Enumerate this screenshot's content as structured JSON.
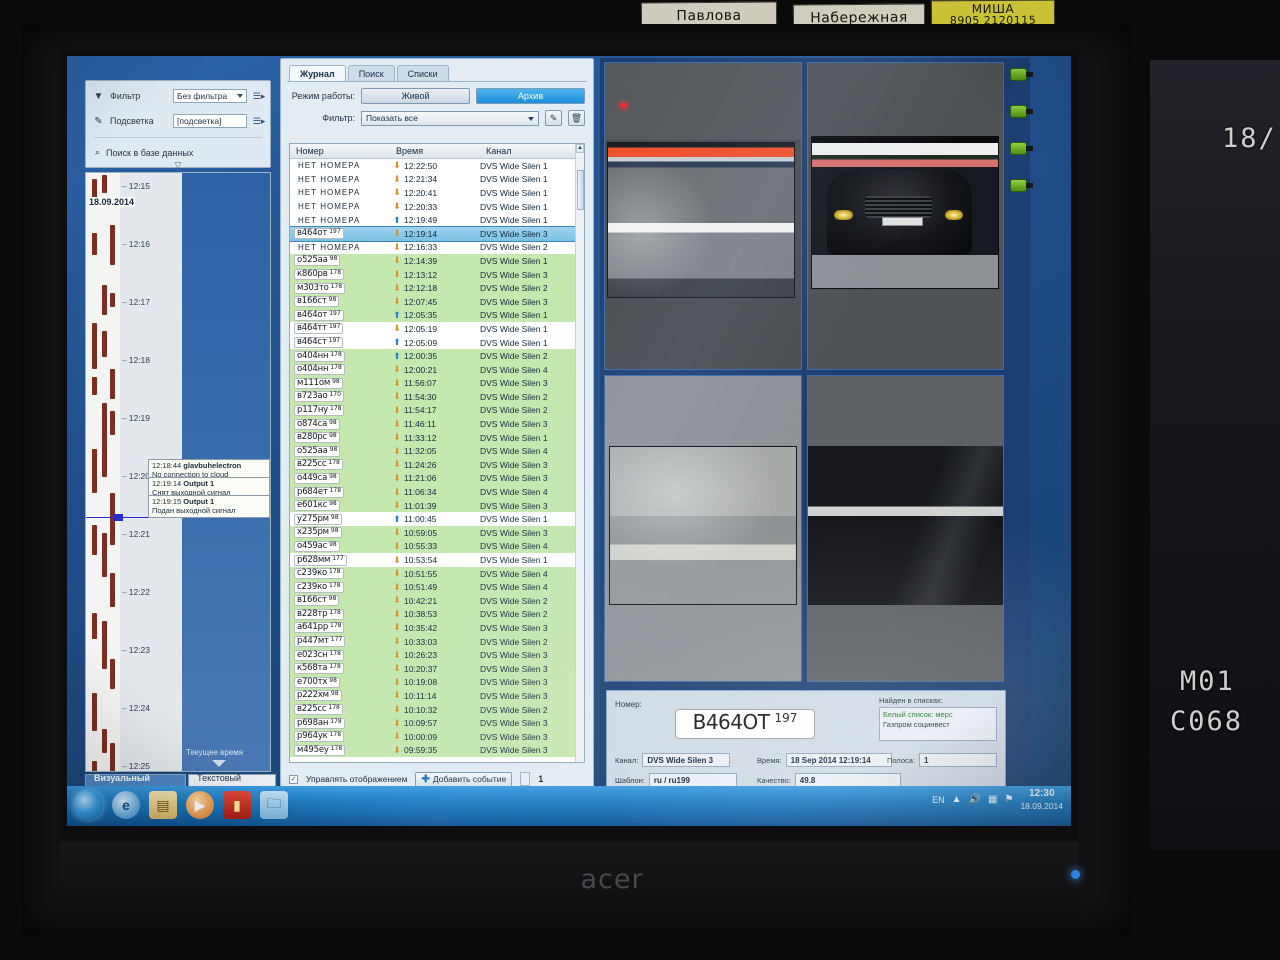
{
  "room": {
    "sticky_notes": [
      {
        "text": "Павлова"
      },
      {
        "text": "Набережная"
      },
      {
        "text": "МИША",
        "text2": "8905 2120115"
      }
    ],
    "second_monitor": {
      "line1": "18/",
      "line2": "M01",
      "line3": "C068"
    },
    "laptop_brand": "acer"
  },
  "left_panel": {
    "filter_label": "Фильтр",
    "filter_value": "Без фильтра",
    "highlight_label": "Подсветка",
    "highlight_placeholder": "[подсветка]",
    "search_db": "Поиск в базе данных",
    "date_stamp": "18.09.2014",
    "ticks": [
      "12:15",
      "12:16",
      "12:17",
      "12:18",
      "12:19",
      "12:20",
      "12:21",
      "12:22",
      "12:23",
      "12:24",
      "12:25"
    ],
    "current_time_label": "Текущее время",
    "tooltips": [
      {
        "time": "12:18:44",
        "title": "glavbuhelectron",
        "body": "No connection to cloud"
      },
      {
        "time": "12:19:14",
        "title": "Output 1",
        "body": "Снят выходной сигнал"
      },
      {
        "time": "12:19:15",
        "title": "Output 1",
        "body": "Подан выходной сигнал"
      }
    ],
    "mode_tabs": [
      {
        "label": "Визуальный режим",
        "active": true
      },
      {
        "label": "Текстовый режим",
        "active": false
      }
    ]
  },
  "journal": {
    "tabs": [
      {
        "label": "Журнал",
        "active": true
      },
      {
        "label": "Поиск",
        "active": false
      },
      {
        "label": "Списки",
        "active": false
      }
    ],
    "mode_label": "Режим работы:",
    "mode_live": "Живой",
    "mode_archive": "Архив",
    "filter_label": "Фильтр:",
    "filter_value": "Показать все",
    "edit_icon": "pencil-icon",
    "delete_icon": "trash-icon",
    "columns": [
      "Номер",
      "Время",
      "Канал"
    ],
    "footer": {
      "checkbox_label": "Управлять отображением",
      "checkbox_checked": true,
      "add_event": "Добавить событие",
      "counter": "1"
    },
    "rows": [
      {
        "plate": null,
        "noplate": "НЕТ НОМЕРА",
        "dir": "down",
        "time": "12:22:50",
        "channel": "DVS Wide Silen 1",
        "bg": "white"
      },
      {
        "plate": null,
        "noplate": "НЕТ НОМЕРА",
        "dir": "down",
        "time": "12:21:34",
        "channel": "DVS Wide Silen 1",
        "bg": "white"
      },
      {
        "plate": null,
        "noplate": "НЕТ НОМЕРА",
        "dir": "down",
        "time": "12:20:41",
        "channel": "DVS Wide Silen 1",
        "bg": "white"
      },
      {
        "plate": null,
        "noplate": "НЕТ НОМЕРА",
        "dir": "down",
        "time": "12:20:33",
        "channel": "DVS Wide Silen 1",
        "bg": "white"
      },
      {
        "plate": null,
        "noplate": "НЕТ НОМЕРА",
        "dir": "up",
        "time": "12:19:49",
        "channel": "DVS Wide Silen 1",
        "bg": "white"
      },
      {
        "plate": "в464от",
        "region": "197",
        "dir": "down",
        "time": "12:19:14",
        "channel": "DVS Wide Silen 3",
        "bg": "sel"
      },
      {
        "plate": null,
        "noplate": "НЕТ НОМЕРА",
        "dir": "down",
        "time": "12:16:33",
        "channel": "DVS Wide Silen 2",
        "bg": "white"
      },
      {
        "plate": "о525аа",
        "region": "98",
        "dir": "down",
        "time": "12:14:39",
        "channel": "DVS Wide Silen 1",
        "bg": "green"
      },
      {
        "plate": "к860рв",
        "region": "178",
        "dir": "down",
        "time": "12:13:12",
        "channel": "DVS Wide Silen 3",
        "bg": "green"
      },
      {
        "plate": "м303то",
        "region": "178",
        "dir": "down",
        "time": "12:12:18",
        "channel": "DVS Wide Silen 2",
        "bg": "green"
      },
      {
        "plate": "в166ст",
        "region": "98",
        "dir": "down",
        "time": "12:07:45",
        "channel": "DVS Wide Silen 3",
        "bg": "green"
      },
      {
        "plate": "в464от",
        "region": "197",
        "dir": "up",
        "time": "12:05:35",
        "channel": "DVS Wide Silen 1",
        "bg": "green"
      },
      {
        "plate": "в464тт",
        "region": "197",
        "dir": "down",
        "time": "12:05:19",
        "channel": "DVS Wide Silen 1",
        "bg": "white"
      },
      {
        "plate": "в464ст",
        "region": "197",
        "dir": "up",
        "time": "12:05:09",
        "channel": "DVS Wide Silen 1",
        "bg": "white"
      },
      {
        "plate": "о404нн",
        "region": "178",
        "dir": "up",
        "time": "12:00:35",
        "channel": "DVS Wide Silen 2",
        "bg": "green"
      },
      {
        "plate": "о404нн",
        "region": "178",
        "dir": "down",
        "time": "12:00:21",
        "channel": "DVS Wide Silen 4",
        "bg": "green"
      },
      {
        "plate": "м111ом",
        "region": "98",
        "dir": "down",
        "time": "11:56:07",
        "channel": "DVS Wide Silen 3",
        "bg": "green"
      },
      {
        "plate": "в723ао",
        "region": "170",
        "dir": "down",
        "time": "11:54:30",
        "channel": "DVS Wide Silen 2",
        "bg": "green"
      },
      {
        "plate": "р117ну",
        "region": "178",
        "dir": "down",
        "time": "11:54:17",
        "channel": "DVS Wide Silen 2",
        "bg": "green"
      },
      {
        "plate": "о874са",
        "region": "98",
        "dir": "down",
        "time": "11:46:11",
        "channel": "DVS Wide Silen 3",
        "bg": "green"
      },
      {
        "plate": "в280рс",
        "region": "98",
        "dir": "down",
        "time": "11:33:12",
        "channel": "DVS Wide Silen 1",
        "bg": "green"
      },
      {
        "plate": "о525аа",
        "region": "98",
        "dir": "down",
        "time": "11:32:05",
        "channel": "DVS Wide Silen 4",
        "bg": "green"
      },
      {
        "plate": "в225сс",
        "region": "178",
        "dir": "down",
        "time": "11:24:26",
        "channel": "DVS Wide Silen 3",
        "bg": "green"
      },
      {
        "plate": "о449са",
        "region": "98",
        "dir": "down",
        "time": "11:21:06",
        "channel": "DVS Wide Silen 3",
        "bg": "green"
      },
      {
        "plate": "р684ет",
        "region": "178",
        "dir": "down",
        "time": "11:06:34",
        "channel": "DVS Wide Silen 4",
        "bg": "green"
      },
      {
        "plate": "е601кс",
        "region": "98",
        "dir": "down",
        "time": "11:01:39",
        "channel": "DVS Wide Silen 3",
        "bg": "green"
      },
      {
        "plate": "у275рм",
        "region": "98",
        "dir": "up",
        "time": "11:00:45",
        "channel": "DVS Wide Silen 1",
        "bg": "white"
      },
      {
        "plate": "х235рм",
        "region": "98",
        "dir": "down",
        "time": "10:59:05",
        "channel": "DVS Wide Silen 3",
        "bg": "green"
      },
      {
        "plate": "о459ас",
        "region": "98",
        "dir": "down",
        "time": "10:55:33",
        "channel": "DVS Wide Silen 4",
        "bg": "green"
      },
      {
        "plate": "р628мм",
        "region": "177",
        "dir": "down",
        "time": "10:53:54",
        "channel": "DVS Wide Silen 1",
        "bg": "white"
      },
      {
        "plate": "с239ко",
        "region": "178",
        "dir": "down",
        "time": "10:51:55",
        "channel": "DVS Wide Silen 4",
        "bg": "green"
      },
      {
        "plate": "с239ко",
        "region": "178",
        "dir": "down",
        "time": "10:51:49",
        "channel": "DVS Wide Silen 4",
        "bg": "green"
      },
      {
        "plate": "в166ст",
        "region": "98",
        "dir": "down",
        "time": "10:42:21",
        "channel": "DVS Wide Silen 2",
        "bg": "green"
      },
      {
        "plate": "в228тр",
        "region": "178",
        "dir": "down",
        "time": "10:38:53",
        "channel": "DVS Wide Silen 2",
        "bg": "green"
      },
      {
        "plate": "а641рр",
        "region": "178",
        "dir": "down",
        "time": "10:35:42",
        "channel": "DVS Wide Silen 3",
        "bg": "green"
      },
      {
        "plate": "р447мт",
        "region": "177",
        "dir": "down",
        "time": "10:33:03",
        "channel": "DVS Wide Silen 2",
        "bg": "green"
      },
      {
        "plate": "е023сн",
        "region": "178",
        "dir": "down",
        "time": "10:26:23",
        "channel": "DVS Wide Silen 3",
        "bg": "green"
      },
      {
        "plate": "к568та",
        "region": "178",
        "dir": "down",
        "time": "10:20:37",
        "channel": "DVS Wide Silen 3",
        "bg": "green"
      },
      {
        "plate": "е700тх",
        "region": "98",
        "dir": "down",
        "time": "10:19:08",
        "channel": "DVS Wide Silen 3",
        "bg": "green"
      },
      {
        "plate": "р222хм",
        "region": "98",
        "dir": "down",
        "time": "10:11:14",
        "channel": "DVS Wide Silen 3",
        "bg": "green"
      },
      {
        "plate": "в225сс",
        "region": "178",
        "dir": "down",
        "time": "10:10:32",
        "channel": "DVS Wide Silen 2",
        "bg": "green"
      },
      {
        "plate": "р698ан",
        "region": "178",
        "dir": "down",
        "time": "10:09:57",
        "channel": "DVS Wide Silen 3",
        "bg": "green"
      },
      {
        "plate": "р964ук",
        "region": "178",
        "dir": "down",
        "time": "10:00:09",
        "channel": "DVS Wide Silen 3",
        "bg": "green"
      },
      {
        "plate": "м495еу",
        "region": "178",
        "dir": "down",
        "time": "09:59:35",
        "channel": "DVS Wide Silen 3",
        "bg": "green"
      }
    ]
  },
  "detail": {
    "number_label": "Номер:",
    "plate_main": "В464ОТ",
    "plate_region": "197",
    "found_label": "Найден в списках:",
    "found_list_1": "Белый список: мерс",
    "found_list_2": "Газпром социнвест",
    "channel_label": "Канал:",
    "channel_value": "DVS Wide Silen 3",
    "time_label": "Время:",
    "time_value": "18 Sep 2014 12:19:14",
    "lane_label": "Полоса:",
    "lane_value": "1",
    "template_label": "Шаблон:",
    "template_value": "ru / ru199",
    "quality_label": "Качество:",
    "quality_value": "49.8"
  },
  "taskbar": {
    "start_icon": "windows-start-icon",
    "items": [
      {
        "icon": "internet-explorer-icon"
      },
      {
        "icon": "explorer-folder-icon"
      },
      {
        "icon": "media-player-icon"
      },
      {
        "icon": "anpr-app-icon"
      },
      {
        "icon": "file-folder-icon"
      }
    ],
    "language": "EN",
    "tray_icons": [
      "show-hidden-icon",
      "volume-icon",
      "network-icon",
      "flag-icon"
    ],
    "clock_time": "12:30",
    "clock_date": "18.09.2014"
  }
}
